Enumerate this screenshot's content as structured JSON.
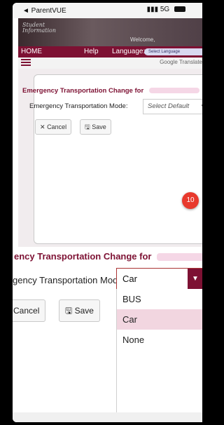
{
  "status_bar": {
    "back_label": "◄ ParentVUE",
    "signal": "5G"
  },
  "header": {
    "logo_line1": "Student",
    "logo_line2": "Information",
    "welcome": "Welcome,"
  },
  "nav": {
    "home": "HOME",
    "help": "Help",
    "language": "Language:",
    "select_language": "Select Language"
  },
  "google": {
    "translate": "Google Translate"
  },
  "modal_small": {
    "title": "Emergency Transportation Change for",
    "mode_label": "Emergency Transportation Mode:",
    "mode_value": "Select Default",
    "cancel_label": "Cancel",
    "save_label": "Save"
  },
  "step_badge": "10",
  "zoom": {
    "title": "ency Transportation Change for",
    "mode_label": "gency Transportation Mode:",
    "selected_value": "Car",
    "cancel_label": "Cancel",
    "save_label": "Save",
    "options": [
      "BUS",
      "Car",
      "None"
    ]
  }
}
